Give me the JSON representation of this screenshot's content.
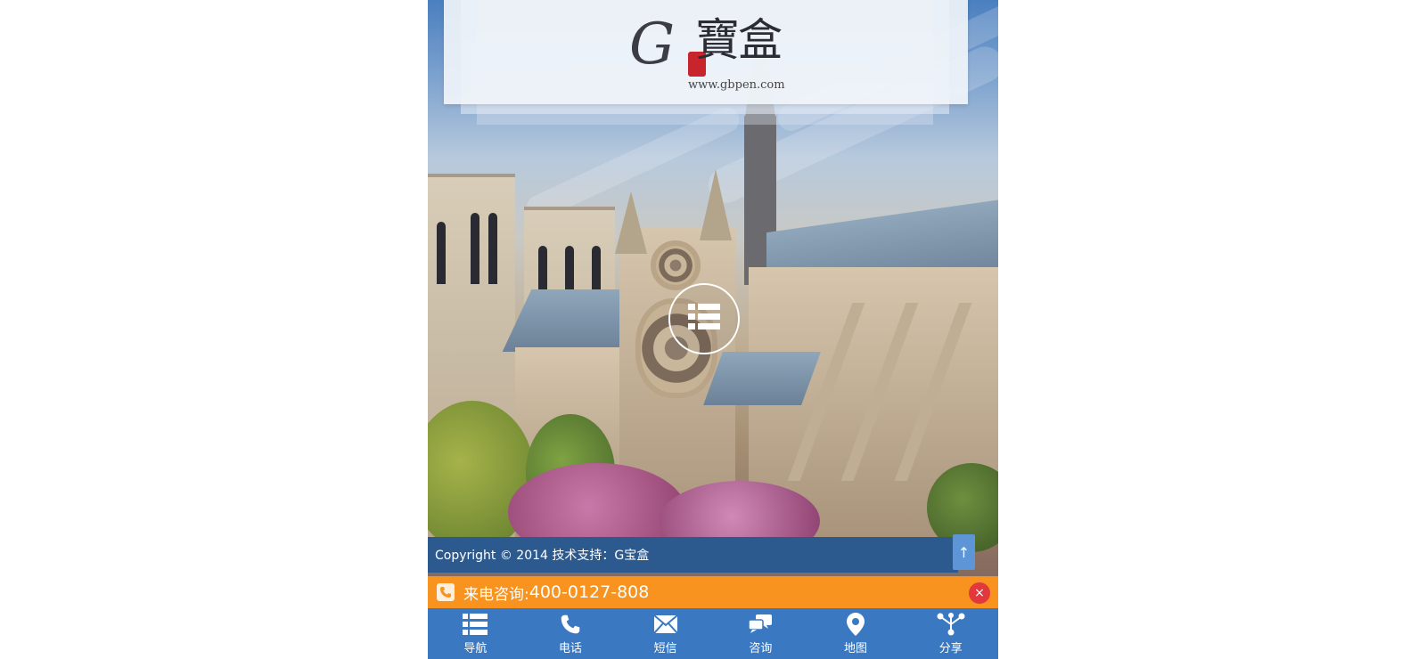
{
  "header": {
    "logo_alt": "G宝盒",
    "logo_mark": "G",
    "logo_chars": "寶盒",
    "logo_url_text": "www.gbpen.com"
  },
  "menu": {
    "icon": "list-icon"
  },
  "footer": {
    "copyright": "Copyright © 2014 技术支持：G宝盒",
    "back_to_top": "↑"
  },
  "call_bar": {
    "label": "来电咨询:",
    "number": "400-0127-808",
    "close": "×"
  },
  "bottom_nav": {
    "items": [
      {
        "label": "导航",
        "icon": "list-icon"
      },
      {
        "label": "电话",
        "icon": "phone-icon"
      },
      {
        "label": "短信",
        "icon": "envelope-icon"
      },
      {
        "label": "咨询",
        "icon": "chat-icon"
      },
      {
        "label": "地图",
        "icon": "map-pin-icon"
      },
      {
        "label": "分享",
        "icon": "share-icon"
      }
    ]
  },
  "colors": {
    "nav_bg": "#3a78c2",
    "call_bar_bg": "#f7931e",
    "copyright_bg": "#2d5a8e",
    "close_btn": "#e2383d"
  }
}
